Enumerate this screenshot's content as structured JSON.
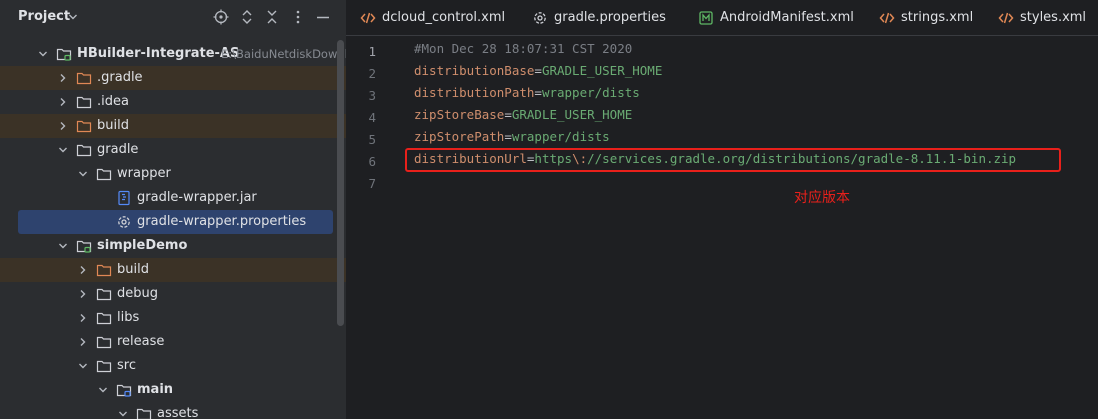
{
  "panel": {
    "title": "Project",
    "icons": [
      "crosshair-icon",
      "expand-all-icon",
      "collapse-all-icon",
      "more-options-icon",
      "minimize-icon"
    ]
  },
  "tree": [
    {
      "label": "HBuilder-Integrate-AS",
      "path": "E:\\BaiduNetdiskDownloa",
      "bold": true,
      "indent": 0,
      "expanded": true,
      "icon": "module-folder-icon",
      "hl": false,
      "sel": false
    },
    {
      "label": ".gradle",
      "indent": 1,
      "expanded": false,
      "icon": "folder-excluded-icon",
      "hl": true,
      "sel": false
    },
    {
      "label": ".idea",
      "indent": 1,
      "expanded": false,
      "icon": "folder-icon",
      "hl": false,
      "sel": false
    },
    {
      "label": "build",
      "indent": 1,
      "expanded": false,
      "icon": "folder-excluded-icon",
      "hl": true,
      "sel": false
    },
    {
      "label": "gradle",
      "indent": 1,
      "expanded": true,
      "icon": "folder-icon",
      "hl": false,
      "sel": false
    },
    {
      "label": "wrapper",
      "indent": 2,
      "expanded": true,
      "icon": "folder-icon",
      "hl": false,
      "sel": false
    },
    {
      "label": "gradle-wrapper.jar",
      "indent": 3,
      "leaf": true,
      "icon": "jar-file-icon",
      "hl": false,
      "sel": false
    },
    {
      "label": "gradle-wrapper.properties",
      "indent": 3,
      "leaf": true,
      "icon": "properties-file-icon",
      "hl": false,
      "sel": true
    },
    {
      "label": "simpleDemo",
      "bold": true,
      "indent": 1,
      "expanded": true,
      "icon": "module-folder-icon",
      "hl": false,
      "sel": false
    },
    {
      "label": "build",
      "indent": 2,
      "expanded": false,
      "icon": "folder-excluded-icon",
      "hl": true,
      "sel": false
    },
    {
      "label": "debug",
      "indent": 2,
      "expanded": false,
      "icon": "folder-icon",
      "hl": false,
      "sel": false
    },
    {
      "label": "libs",
      "indent": 2,
      "expanded": false,
      "icon": "folder-icon",
      "hl": false,
      "sel": false
    },
    {
      "label": "release",
      "indent": 2,
      "expanded": false,
      "icon": "folder-icon",
      "hl": false,
      "sel": false
    },
    {
      "label": "src",
      "indent": 2,
      "expanded": true,
      "icon": "folder-icon",
      "hl": false,
      "sel": false
    },
    {
      "label": "main",
      "bold": true,
      "indent": 3,
      "expanded": true,
      "icon": "source-folder-icon",
      "hl": false,
      "sel": false
    },
    {
      "label": "assets",
      "indent": 4,
      "expanded": true,
      "icon": "folder-icon",
      "hl": false,
      "sel": false
    }
  ],
  "tabs": [
    {
      "label": "dcloud_control.xml",
      "icon": "xml-file-icon"
    },
    {
      "label": "gradle.properties",
      "icon": "properties-file-icon"
    },
    {
      "label": "AndroidManifest.xml",
      "icon": "manifest-file-icon"
    },
    {
      "label": "strings.xml",
      "icon": "xml-file-icon"
    },
    {
      "label": "styles.xml",
      "icon": "xml-file-icon"
    }
  ],
  "line_numbers": [
    "1",
    "2",
    "3",
    "4",
    "5",
    "6",
    "7"
  ],
  "code": [
    {
      "comment": "#Mon Dec 28 18:07:31 CST 2020"
    },
    {
      "key": "distributionBase",
      "eq": "=",
      "val": "GRADLE_USER_HOME"
    },
    {
      "key": "distributionPath",
      "eq": "=",
      "val": "wrapper/dists"
    },
    {
      "key": "zipStoreBase",
      "eq": "=",
      "val": "GRADLE_USER_HOME"
    },
    {
      "key": "zipStorePath",
      "eq": "=",
      "val": "wrapper/dists"
    },
    {
      "key": "distributionUrl",
      "eq": "=",
      "val": "https",
      "esc": "\\:",
      "val2": "//services.gradle.org/distributions/gradle-8.11.1-bin.zip"
    },
    {}
  ],
  "annotation": "对应版本",
  "colors": {
    "panel_bg": "#2b2d30",
    "editor_bg": "#1e1f22",
    "selection": "#2e436e",
    "excluded_row": "#3b3226",
    "annotation_red": "#e8201b",
    "string_green": "#6aab73",
    "key_orange": "#cf8e6d"
  }
}
